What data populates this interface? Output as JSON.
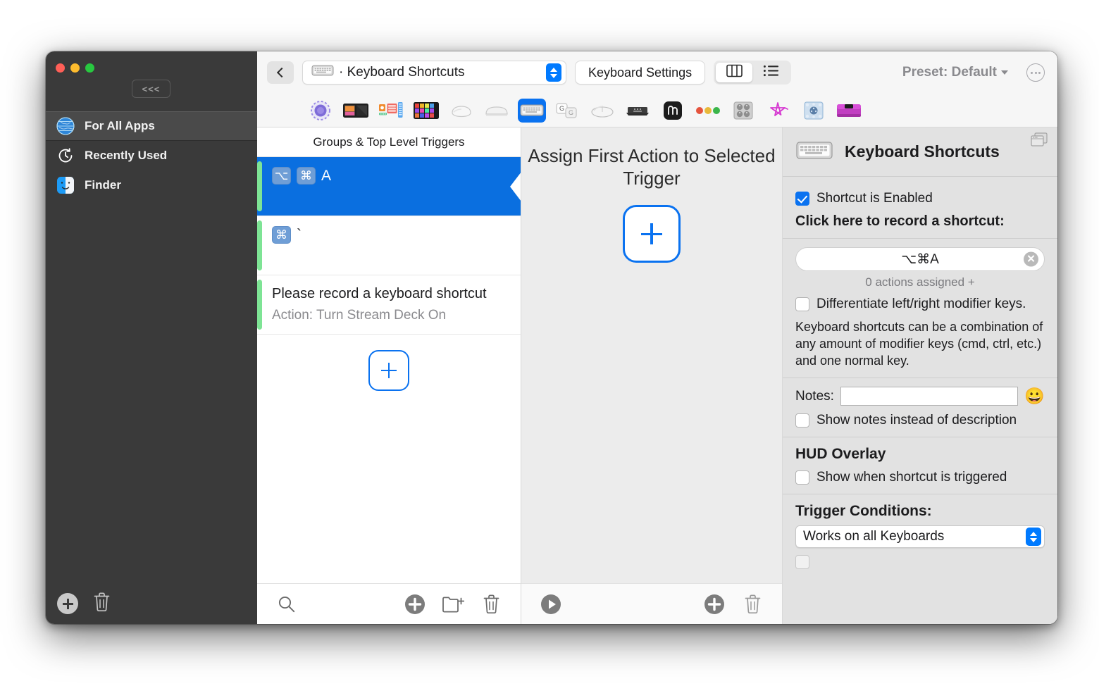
{
  "window": {
    "traffic_lights": [
      "close",
      "minimize",
      "maximize"
    ],
    "collapse_label": "<<<"
  },
  "sidebar": {
    "items": [
      {
        "label": "For All Apps",
        "icon": "globe-icon",
        "selected": true
      },
      {
        "label": "Recently Used",
        "icon": "clock-icon",
        "selected": false
      },
      {
        "label": "Finder",
        "icon": "finder-icon",
        "selected": false
      }
    ],
    "footer": {
      "add": "+",
      "delete": "trash-icon"
    }
  },
  "toolbar": {
    "back_icon": "chevron-left-icon",
    "combo_value": "· Keyboard Shortcuts",
    "combo_icon": "keyboard-icon",
    "keyboard_settings_label": "Keyboard Settings",
    "view_columns_icon": "columns-view-icon",
    "view_list_icon": "list-view-icon",
    "preset_label": "Preset: Default",
    "more_icon": "ellipsis-icon"
  },
  "device_tabs": [
    {
      "name": "magic-trackpad-dial-icon",
      "selected": false
    },
    {
      "name": "stream-deck-icon",
      "selected": false
    },
    {
      "name": "midi-controller-icon",
      "selected": false
    },
    {
      "name": "stream-deck-xl-icon",
      "selected": false
    },
    {
      "name": "magic-mouse-icon",
      "selected": false
    },
    {
      "name": "trackpad-icon",
      "selected": false
    },
    {
      "name": "keyboard-icon",
      "selected": true
    },
    {
      "name": "key-sequence-icon",
      "selected": false
    },
    {
      "name": "generic-mouse-icon",
      "selected": false
    },
    {
      "name": "remote-icon",
      "selected": false
    },
    {
      "name": "gesture-icon",
      "selected": false
    },
    {
      "name": "traffic-lights-icon",
      "selected": false
    },
    {
      "name": "knob-controller-icon",
      "selected": false
    },
    {
      "name": "star-drawing-icon",
      "selected": false
    },
    {
      "name": "loupedeck-icon",
      "selected": false
    },
    {
      "name": "touchbar-icon",
      "selected": false
    }
  ],
  "triggers_pane": {
    "header": "Groups & Top Level Triggers",
    "rows": [
      {
        "type": "shortcut",
        "keys": [
          "⌥",
          "⌘"
        ],
        "character": "A",
        "selected": true
      },
      {
        "type": "shortcut",
        "keys": [
          "⌘"
        ],
        "character": "`",
        "selected": false
      },
      {
        "type": "text",
        "title": "Please record a keyboard shortcut",
        "subtitle": "Action: Turn Stream Deck On",
        "selected": false
      }
    ],
    "add_card": "+",
    "footer": {
      "search_icon": "search-icon",
      "add_icon": "add-trigger-icon",
      "new_group_icon": "new-folder-icon",
      "delete_icon": "trash-icon"
    }
  },
  "actions_pane": {
    "title": "Assign First Action to Selected Trigger",
    "add_card": "+",
    "footer": {
      "run_icon": "play-icon",
      "add_icon": "add-action-icon",
      "delete_icon": "trash-icon"
    }
  },
  "inspector": {
    "icon": "keyboard-icon",
    "title": "Keyboard Shortcuts",
    "window_icon": "windows-stack-icon",
    "shortcut_enabled": {
      "label": "Shortcut is Enabled",
      "checked": true
    },
    "record_prompt": "Click here to record a shortcut:",
    "recorded_value": "⌥⌘A",
    "clear_icon": "clear-icon",
    "actions_assigned": "0 actions assigned +",
    "differentiate": {
      "label": "Differentiate left/right modifier keys.",
      "checked": false
    },
    "description": "Keyboard shortcuts can be a combination of any amount of modifier keys (cmd, ctrl, etc.) and one normal key.",
    "notes_label": "Notes:",
    "notes_value": "",
    "notes_placeholder": "",
    "emoji": "😀",
    "show_notes": {
      "label": "Show notes instead of description",
      "checked": false
    },
    "hud_overlay": {
      "title": "HUD Overlay",
      "show_when_triggered": {
        "label": "Show when shortcut is triggered",
        "checked": false
      }
    },
    "trigger_conditions": {
      "title": "Trigger Conditions:",
      "selected": "Works on all Keyboards"
    }
  },
  "colors": {
    "accent_blue": "#0a72f0",
    "selection_blue": "#0a6fe0",
    "green_bar": "#7ee495",
    "sidebar_bg": "#3a3a3a",
    "inspector_bg": "#e2e2e2",
    "actions_bg": "#ececec"
  }
}
